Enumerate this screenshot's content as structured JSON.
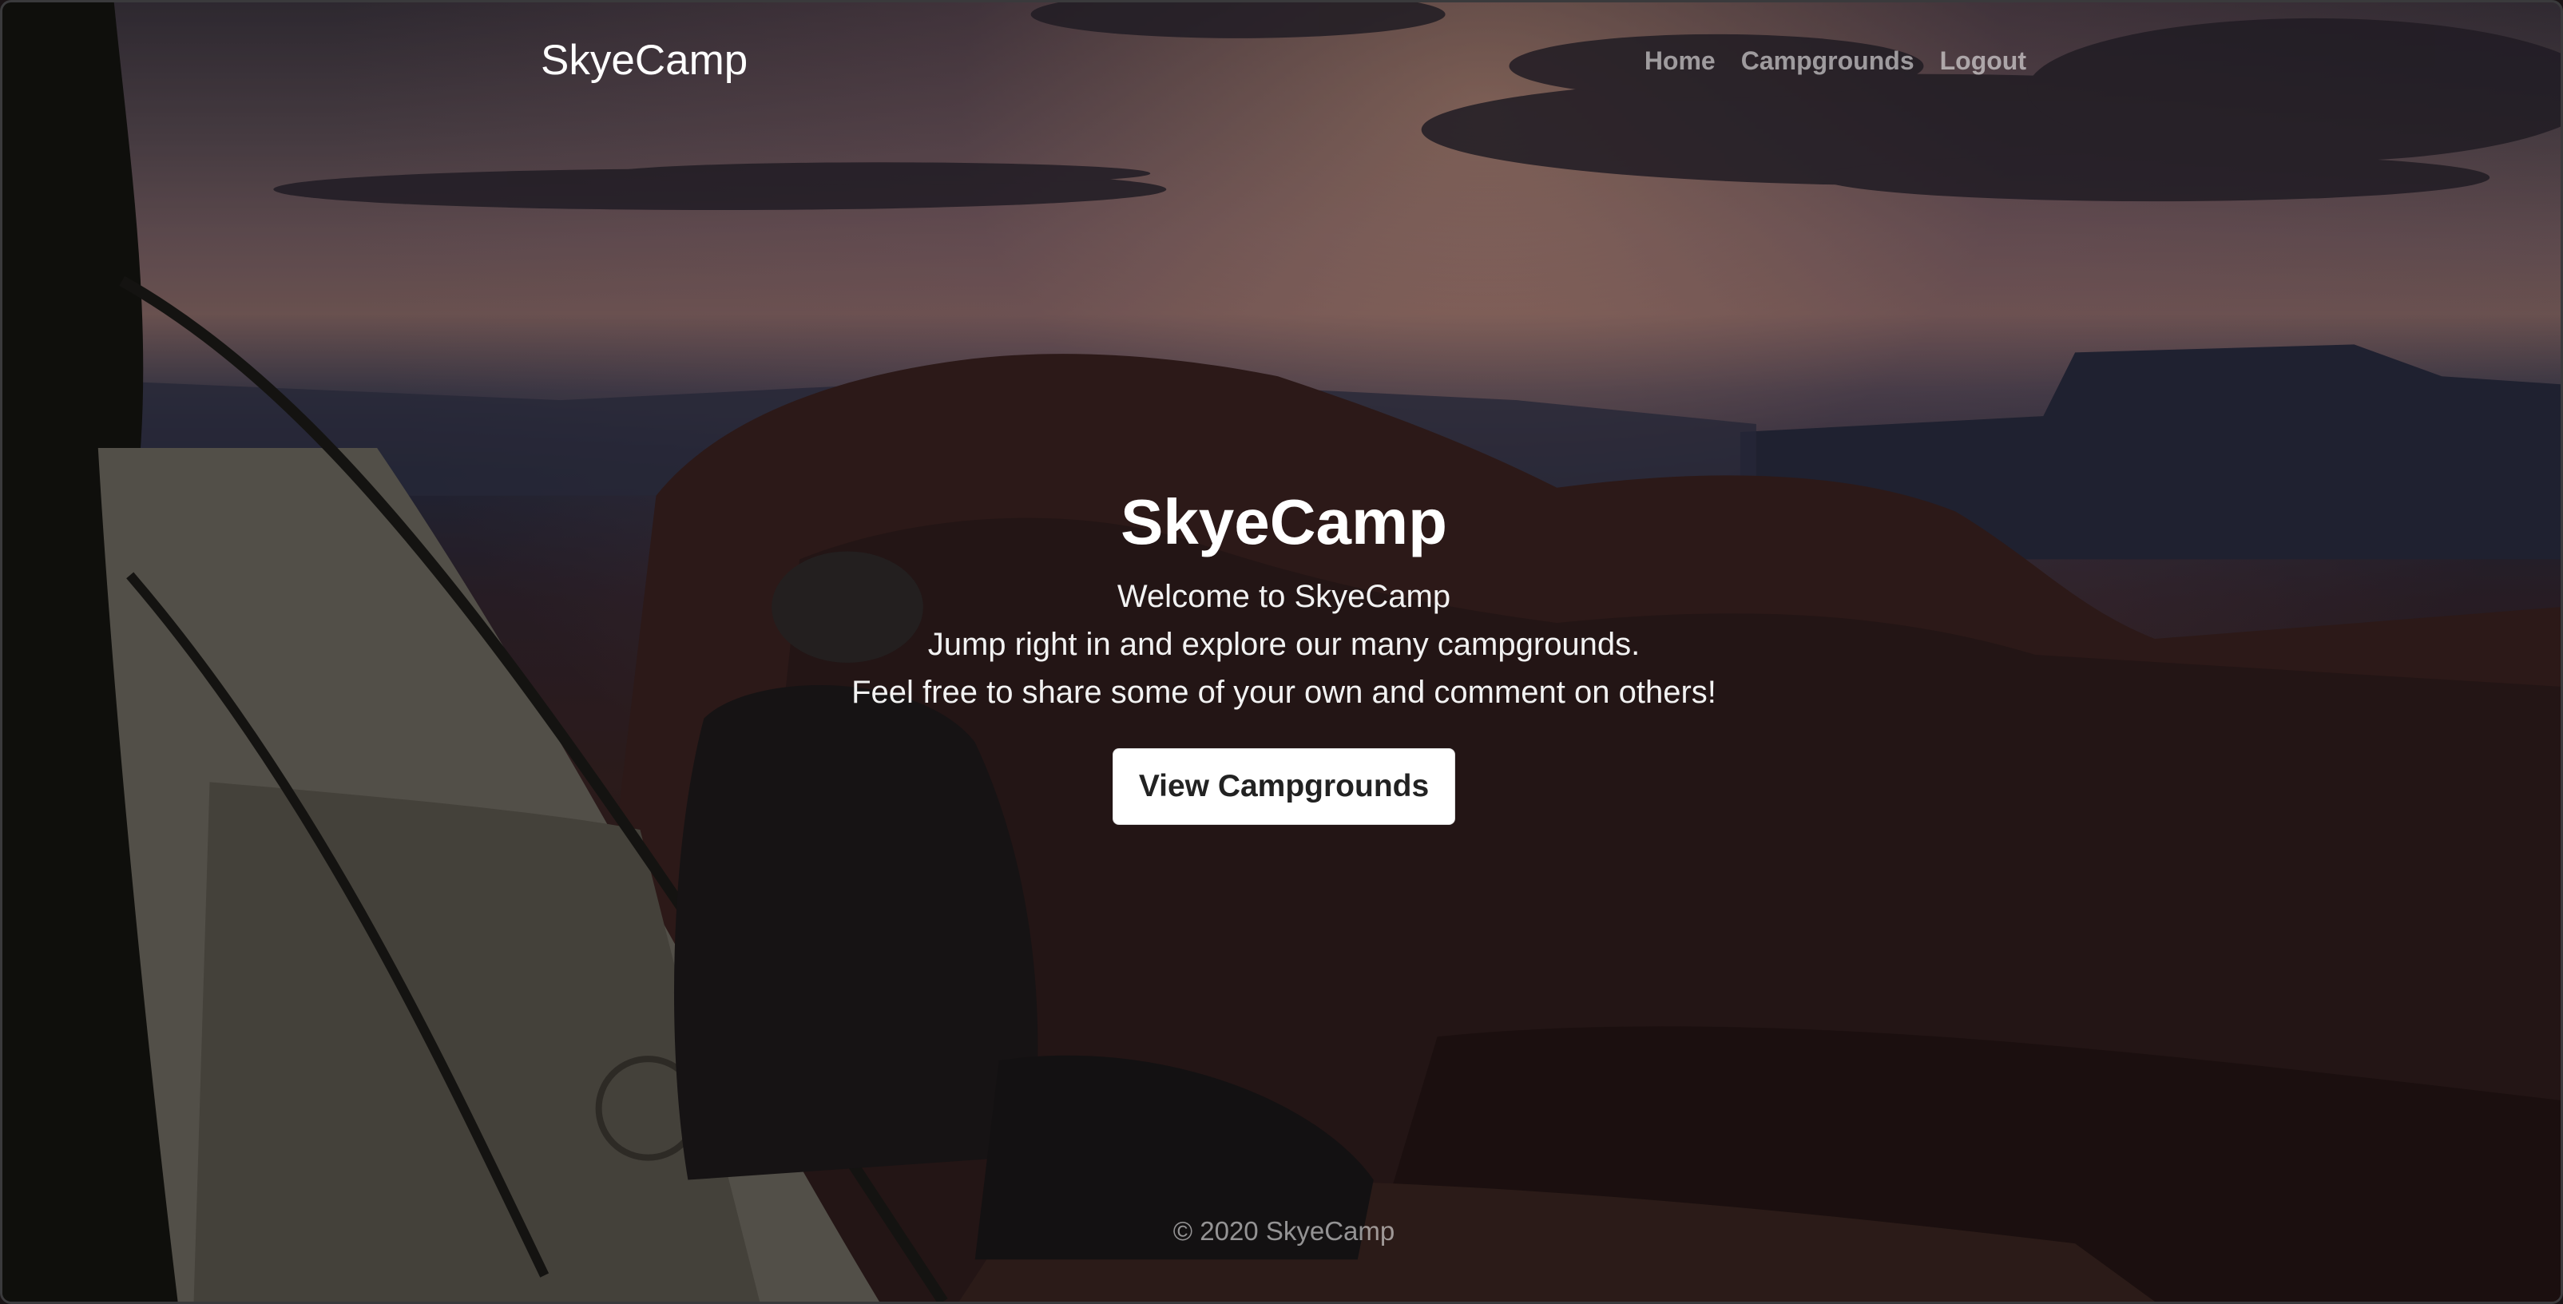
{
  "navbar": {
    "brand": "SkyeCamp",
    "links": [
      {
        "label": "Home"
      },
      {
        "label": "Campgrounds"
      },
      {
        "label": "Logout"
      }
    ]
  },
  "hero": {
    "title": "SkyeCamp",
    "lines": [
      "Welcome to SkyeCamp",
      "Jump right in and explore our many campgrounds.",
      "Feel free to share some of your own and comment on others!"
    ],
    "cta_label": "View Campgrounds"
  },
  "footer": {
    "text": "© 2020 SkyeCamp"
  },
  "colors": {
    "text": "#ffffff",
    "nav_link": "rgba(255,255,255,0.55)",
    "button_bg": "#ffffff",
    "button_text": "#222222"
  }
}
